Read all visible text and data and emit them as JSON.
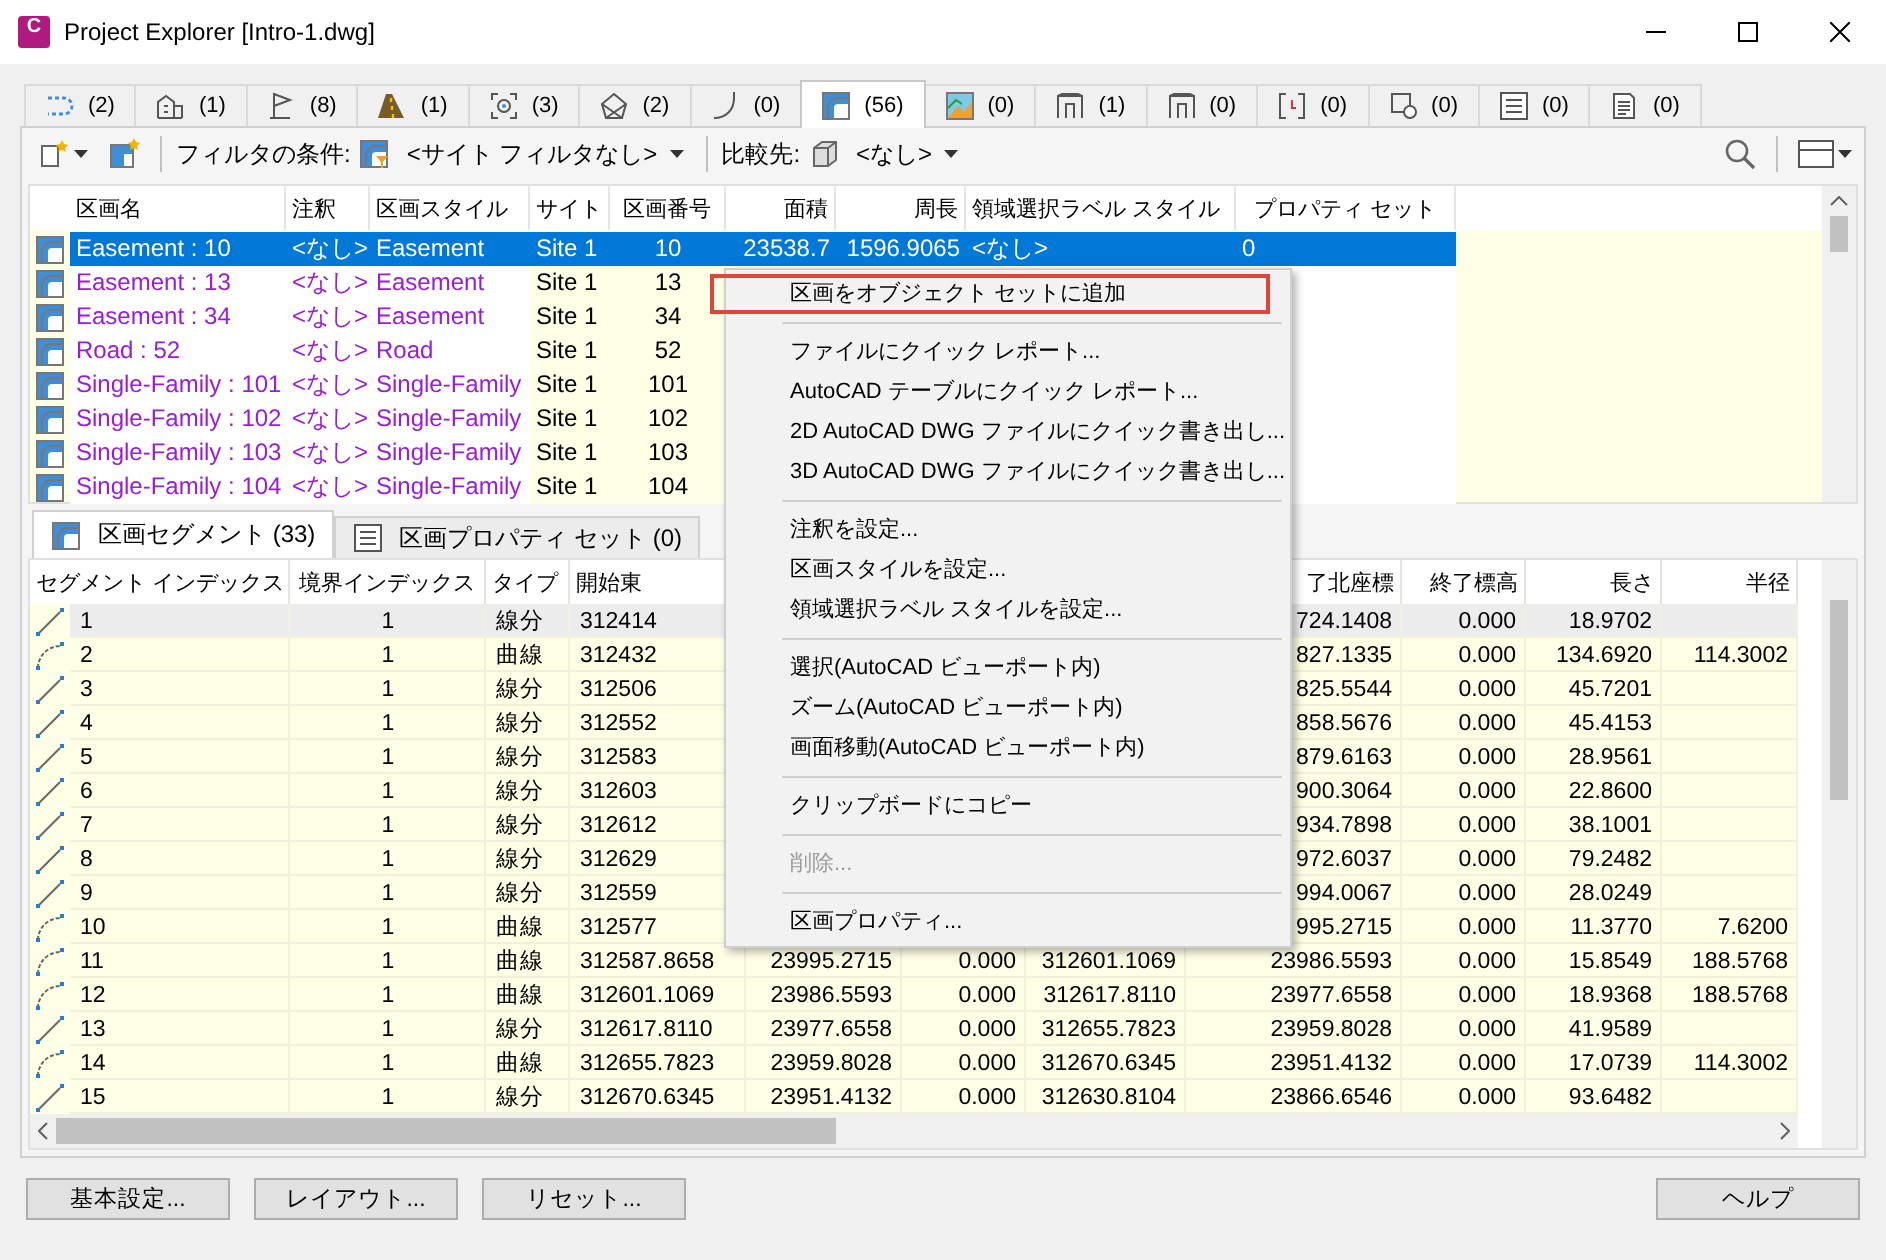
{
  "window": {
    "app_icon_letter": "C",
    "title": "Project Explorer [Intro-1.dwg]"
  },
  "object_tabs": [
    {
      "count": "(2)",
      "selected": false
    },
    {
      "count": "(1)",
      "selected": false
    },
    {
      "count": "(8)",
      "selected": false
    },
    {
      "count": "(1)",
      "selected": false
    },
    {
      "count": "(3)",
      "selected": false
    },
    {
      "count": "(2)",
      "selected": false
    },
    {
      "count": "(0)",
      "selected": false
    },
    {
      "count": "(56)",
      "selected": true
    },
    {
      "count": "(0)",
      "selected": false
    },
    {
      "count": "(1)",
      "selected": false
    },
    {
      "count": "(0)",
      "selected": false
    },
    {
      "count": "(0)",
      "selected": false
    },
    {
      "count": "(0)",
      "selected": false
    },
    {
      "count": "(0)",
      "selected": false
    },
    {
      "count": "(0)",
      "selected": false
    }
  ],
  "toolbar": {
    "filter_label": "フィルタの条件:",
    "site_filter": "<サイト フィルタなし>",
    "compare_label": "比較先:",
    "compare_value": "<なし>"
  },
  "parcels_table": {
    "columns": [
      {
        "label": "区画名",
        "shaded": false
      },
      {
        "label": "注釈",
        "shaded": false
      },
      {
        "label": "区画スタイル",
        "shaded": false
      },
      {
        "label": "サイト",
        "shaded": true
      },
      {
        "label": "区画番号",
        "shaded": true
      },
      {
        "label": "面積"
      },
      {
        "label": "周長"
      },
      {
        "label": "領域選択ラベル スタイル"
      },
      {
        "label": "プロパティ セット"
      }
    ],
    "rows": [
      {
        "selected": true,
        "cells": [
          "Easement : 10",
          "<なし>",
          "Easement",
          "Site 1",
          "10",
          "23538.7",
          "1596.9065",
          "<なし>",
          "0"
        ]
      },
      {
        "selected": false,
        "cells": [
          "Easement : 13",
          "<なし>",
          "Easement",
          "Site 1",
          "13",
          null,
          null,
          null,
          null
        ]
      },
      {
        "selected": false,
        "cells": [
          "Easement : 34",
          "<なし>",
          "Easement",
          "Site 1",
          "34",
          null,
          null,
          null,
          null
        ]
      },
      {
        "selected": false,
        "cells": [
          "Road : 52",
          "<なし>",
          "Road",
          "Site 1",
          "52",
          null,
          null,
          null,
          null
        ]
      },
      {
        "selected": false,
        "cells": [
          "Single-Family : 101",
          "<なし>",
          "Single-Family",
          "Site 1",
          "101",
          null,
          null,
          null,
          null
        ]
      },
      {
        "selected": false,
        "cells": [
          "Single-Family : 102",
          "<なし>",
          "Single-Family",
          "Site 1",
          "102",
          null,
          null,
          null,
          null
        ]
      },
      {
        "selected": false,
        "cells": [
          "Single-Family : 103",
          "<なし>",
          "Single-Family",
          "Site 1",
          "103",
          null,
          null,
          null,
          null
        ]
      },
      {
        "selected": false,
        "cells": [
          "Single-Family : 104",
          "<なし>",
          "Single-Family",
          "Site 1",
          "104",
          null,
          null,
          null,
          null
        ]
      }
    ]
  },
  "detail_tabs": [
    {
      "label": "区画セグメント (33)",
      "selected": true
    },
    {
      "label": "区画プロパティ セット (0)",
      "selected": false
    }
  ],
  "segments_table": {
    "columns": [
      "セグメント インデックス",
      "境界インデックス",
      "タイプ",
      "開始東",
      null,
      null,
      null,
      "了北座標",
      "終了標高",
      "長さ",
      "半径"
    ],
    "rows": [
      {
        "kind": "line",
        "selected": true,
        "cells": [
          "1",
          "1",
          "線分",
          "312414",
          null,
          null,
          null,
          "724.1408",
          "0.000",
          "18.9702",
          null
        ]
      },
      {
        "kind": "arc",
        "selected": false,
        "cells": [
          "2",
          "1",
          "曲線",
          "312432",
          null,
          null,
          null,
          "827.1335",
          "0.000",
          "134.6920",
          "114.3002"
        ]
      },
      {
        "kind": "line",
        "selected": false,
        "cells": [
          "3",
          "1",
          "線分",
          "312506",
          null,
          null,
          null,
          "825.5544",
          "0.000",
          "45.7201",
          null
        ]
      },
      {
        "kind": "line",
        "selected": false,
        "cells": [
          "4",
          "1",
          "線分",
          "312552",
          null,
          null,
          null,
          "858.5676",
          "0.000",
          "45.4153",
          null
        ]
      },
      {
        "kind": "line",
        "selected": false,
        "cells": [
          "5",
          "1",
          "線分",
          "312583",
          null,
          null,
          null,
          "879.6163",
          "0.000",
          "28.9561",
          null
        ]
      },
      {
        "kind": "line",
        "selected": false,
        "cells": [
          "6",
          "1",
          "線分",
          "312603",
          null,
          null,
          null,
          "900.3064",
          "0.000",
          "22.8600",
          null
        ]
      },
      {
        "kind": "line",
        "selected": false,
        "cells": [
          "7",
          "1",
          "線分",
          "312612",
          null,
          null,
          null,
          "934.7898",
          "0.000",
          "38.1001",
          null
        ]
      },
      {
        "kind": "line",
        "selected": false,
        "cells": [
          "8",
          "1",
          "線分",
          "312629",
          null,
          null,
          null,
          "972.6037",
          "0.000",
          "79.2482",
          null
        ]
      },
      {
        "kind": "line",
        "selected": false,
        "cells": [
          "9",
          "1",
          "線分",
          "312559",
          null,
          null,
          null,
          "994.0067",
          "0.000",
          "28.0249",
          null
        ]
      },
      {
        "kind": "arc",
        "selected": false,
        "cells": [
          "10",
          "1",
          "曲線",
          "312577",
          null,
          null,
          null,
          "995.2715",
          "0.000",
          "11.3770",
          "7.6200"
        ]
      },
      {
        "kind": "arc",
        "selected": false,
        "cells": [
          "11",
          "1",
          "曲線",
          "312587.8658",
          "23995.2715",
          "0.000",
          "312601.1069",
          "23986.5593",
          "0.000",
          "15.8549",
          "188.5768"
        ]
      },
      {
        "kind": "arc",
        "selected": false,
        "cells": [
          "12",
          "1",
          "曲線",
          "312601.1069",
          "23986.5593",
          "0.000",
          "312617.8110",
          "23977.6558",
          "0.000",
          "18.9368",
          "188.5768"
        ]
      },
      {
        "kind": "line",
        "selected": false,
        "cells": [
          "13",
          "1",
          "線分",
          "312617.8110",
          "23977.6558",
          "0.000",
          "312655.7823",
          "23959.8028",
          "0.000",
          "41.9589",
          null
        ]
      },
      {
        "kind": "arc",
        "selected": false,
        "cells": [
          "14",
          "1",
          "曲線",
          "312655.7823",
          "23959.8028",
          "0.000",
          "312670.6345",
          "23951.4132",
          "0.000",
          "17.0739",
          "114.3002"
        ]
      },
      {
        "kind": "line",
        "selected": false,
        "cells": [
          "15",
          "1",
          "線分",
          "312670.6345",
          "23951.4132",
          "0.000",
          "312630.8104",
          "23866.6546",
          "0.000",
          "93.6482",
          null
        ]
      }
    ]
  },
  "context_menu": {
    "items": [
      {
        "kind": "item",
        "label": "区画をオブジェクト セットに追加",
        "disabled": false,
        "highlighted": true
      },
      {
        "kind": "separator"
      },
      {
        "kind": "item",
        "label": "ファイルにクイック レポート...",
        "disabled": false,
        "highlighted": false
      },
      {
        "kind": "item",
        "label": "AutoCAD テーブルにクイック レポート...",
        "disabled": false,
        "highlighted": false
      },
      {
        "kind": "item",
        "label": "2D AutoCAD DWG ファイルにクイック書き出し...",
        "disabled": false,
        "highlighted": false
      },
      {
        "kind": "item",
        "label": "3D AutoCAD DWG ファイルにクイック書き出し...",
        "disabled": false,
        "highlighted": false
      },
      {
        "kind": "separator"
      },
      {
        "kind": "item",
        "label": "注釈を設定...",
        "disabled": false,
        "highlighted": false
      },
      {
        "kind": "item",
        "label": "区画スタイルを設定...",
        "disabled": false,
        "highlighted": false
      },
      {
        "kind": "item",
        "label": "領域選択ラベル スタイルを設定...",
        "disabled": false,
        "highlighted": false
      },
      {
        "kind": "separator"
      },
      {
        "kind": "item",
        "label": "選択(AutoCAD ビューポート内)",
        "disabled": false,
        "highlighted": false
      },
      {
        "kind": "item",
        "label": "ズーム(AutoCAD ビューポート内)",
        "disabled": false,
        "highlighted": false
      },
      {
        "kind": "item",
        "label": "画面移動(AutoCAD ビューポート内)",
        "disabled": false,
        "highlighted": false
      },
      {
        "kind": "separator"
      },
      {
        "kind": "item",
        "label": "クリップボードにコピー",
        "disabled": false,
        "highlighted": false
      },
      {
        "kind": "separator"
      },
      {
        "kind": "item",
        "label": "削除...",
        "disabled": true,
        "highlighted": false
      },
      {
        "kind": "separator"
      },
      {
        "kind": "item",
        "label": "区画プロパティ...",
        "disabled": false,
        "highlighted": false
      }
    ]
  },
  "buttons": [
    "基本設定...",
    "レイアウト...",
    "リセット..."
  ],
  "help_button": "ヘルプ"
}
